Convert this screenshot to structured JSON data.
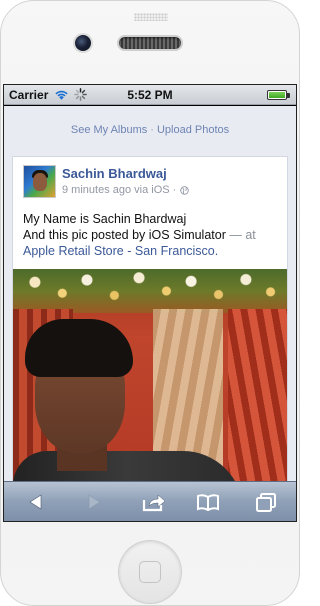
{
  "status_bar": {
    "carrier": "Carrier",
    "time": "5:52 PM",
    "battery_level": 1.0
  },
  "album_links": {
    "see_my_albums": "See My Albums",
    "separator": "·",
    "upload_photos": "Upload Photos"
  },
  "post": {
    "author": "Sachin Bhardwaj",
    "time_ago": "9 minutes ago via iOS",
    "meta_separator": "·",
    "line1": "My Name is Sachin Bhardwaj",
    "line2_prefix": "And this pic posted by iOS Simulator",
    "line2_dash": "— at",
    "location": "Apple Retail Store - San Francisco."
  },
  "icons": {
    "wifi": "wifi-icon",
    "activity": "spinner-icon",
    "battery": "battery-icon",
    "privacy": "globe-icon",
    "back": "back-arrow-icon",
    "forward": "forward-arrow-icon",
    "share": "share-icon",
    "bookmarks": "bookmarks-icon",
    "tabs": "tabs-icon"
  },
  "colors": {
    "link_blue": "#3b5998",
    "light_link": "#6d84b4",
    "page_bg": "#e9ebf2",
    "toolbar": "#8fa0b7"
  }
}
